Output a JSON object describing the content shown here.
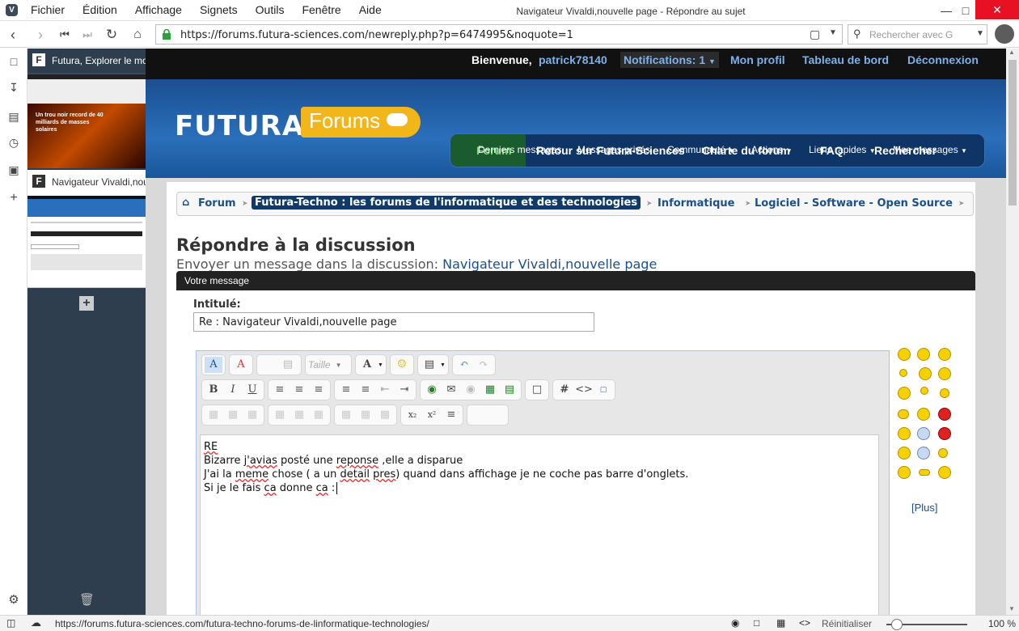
{
  "menubar": {
    "items": [
      "Fichier",
      "Édition",
      "Affichage",
      "Signets",
      "Outils",
      "Fenêtre",
      "Aide"
    ],
    "window_title": "Navigateur Vivaldi,nouvelle page - Répondre au sujet"
  },
  "navbar": {
    "url": "https://forums.futura-sciences.com/newreply.php?p=6474995&noquote=1",
    "search_placeholder": "Rechercher avec G"
  },
  "tabs": [
    {
      "title": "Futura, Explorer le monde"
    },
    {
      "title": "Navigateur Vivaldi,nouvelle page"
    }
  ],
  "thumb1": {
    "headline": "Un trou noir record de 40 milliards de masses solaires"
  },
  "topbar": {
    "welcome": "Bienvenue,",
    "user": "patrick78140",
    "notifications": "Notifications: 1",
    "profile": "Mon profil",
    "dashboard": "Tableau de bord",
    "logout": "Déconnexion"
  },
  "logo": {
    "futura": "FUTURA",
    "forums": "Forums"
  },
  "mainnav": [
    "Forum",
    "Retour sur Futura-Sciences",
    "Charte du forum",
    "FAQ",
    "Rechercher"
  ],
  "subnav": [
    "Derniers messages",
    "Messages privés",
    "Communauté",
    "Actions",
    "Liens rapides",
    "Mes messages"
  ],
  "breadcrumb": [
    "Forum",
    "Futura-Techno : les forums de l'informatique et des technologies",
    "Informatique",
    "Logiciel - Software - Open Source"
  ],
  "page": {
    "title": "Répondre à la discussion",
    "subtitle_prefix": "Envoyer un message dans la discussion:",
    "subtitle_link": "Navigateur Vivaldi,nouvelle page",
    "msgbar": "Votre message",
    "title_label": "Intitulé:",
    "title_value": "Re : Navigateur Vivaldi,nouvelle page",
    "size_label": "Taille",
    "more_smilies": "[Plus]"
  },
  "editor_lines": {
    "l1": "RE",
    "l2a": "Bizarre ",
    "l2b": "j'avias",
    "l2c": " posté une ",
    "l2d": "reponse",
    "l2e": " ,elle a disparue",
    "l3a": "J'ai la ",
    "l3b": "meme",
    "l3c": " chose ( a un ",
    "l3d": "detail",
    "l3e": " ",
    "l3f": "pres",
    "l3g": ") quand dans affichage je ne coche pas barre d'onglets.",
    "l4a": "Si je le fais ",
    "l4b": "ca",
    "l4c": " donne ",
    "l4d": "ca",
    "l4e": " :"
  },
  "statusbar": {
    "url": "https://forums.futura-sciences.com/futura-techno-forums-de-linformatique-technologies/",
    "reset": "Réinitialiser",
    "zoom": "100 %"
  },
  "colors": {
    "accent_blue": "#1d4f89",
    "hero_blue": "#2a6fbb",
    "logo_yellow": "#f2b51a",
    "tabpanel": "#2e3e4e"
  }
}
